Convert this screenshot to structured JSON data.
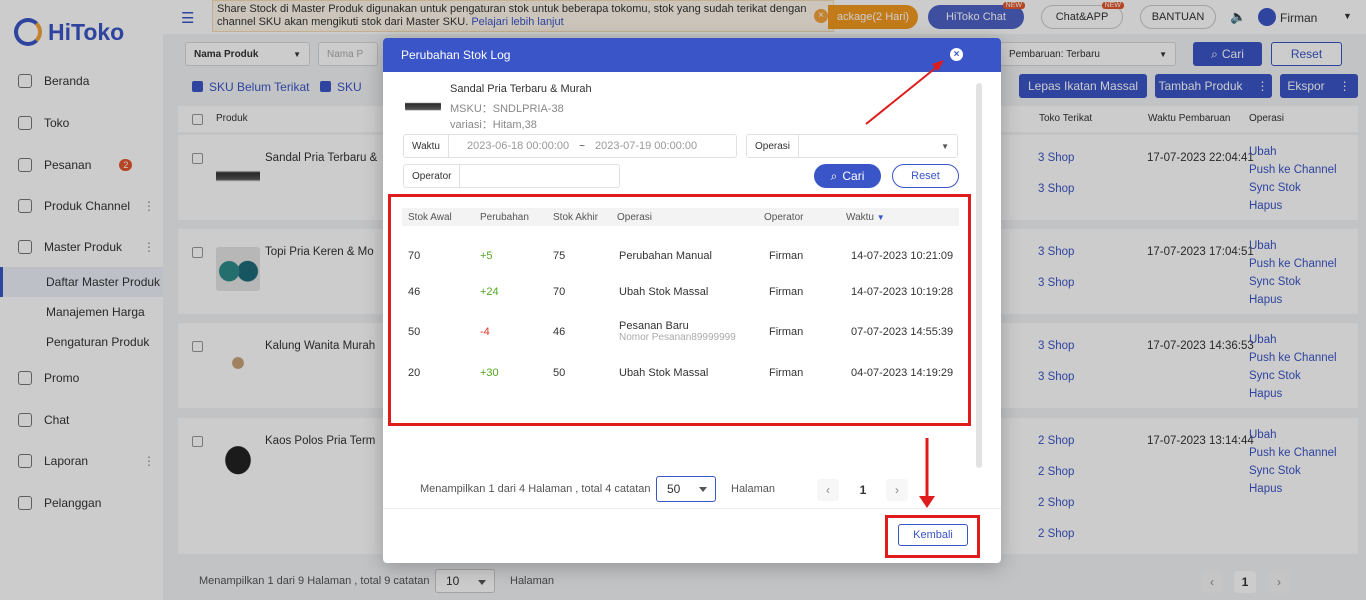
{
  "app": {
    "logo": "HiToko"
  },
  "sidebar": {
    "items": [
      {
        "label": "Beranda"
      },
      {
        "label": "Toko"
      },
      {
        "label": "Pesanan",
        "badge": "2"
      },
      {
        "label": "Produk Channel"
      },
      {
        "label": "Master Produk"
      },
      {
        "label": "Daftar Master Produk"
      },
      {
        "label": "Manajemen Harga"
      },
      {
        "label": "Pengaturan Produk"
      },
      {
        "label": "Promo"
      },
      {
        "label": "Chat"
      },
      {
        "label": "Laporan"
      },
      {
        "label": "Pelanggan"
      }
    ]
  },
  "topbar": {
    "notice_text": "Share Stock di Master Produk digunakan untuk pengaturan stok untuk beberapa tokomu, stok yang sudah terikat dengan channel SKU akan mengikuti stok dari Master SKU.",
    "notice_link": "Pelajari lebih lanjut",
    "package": "ackage(2 Hari)",
    "hitoko_chat": "HiToko Chat",
    "chat_app": "Chat&APP",
    "new_tag": "NEW",
    "bantuan": "BANTUAN",
    "user": "Firman"
  },
  "filters": {
    "nama_produk": "Nama Produk",
    "nama_p": "Nama P",
    "pembaruan": "Pembaruan: Terbaru",
    "cari": "Cari",
    "reset": "Reset",
    "sku_belum": "SKU Belum Terikat",
    "sku2": "SKU",
    "lepas": "Lepas Ikatan Massal",
    "tambah": "Tambah Produk",
    "ekspor": "Ekspor"
  },
  "list": {
    "headers": {
      "produk": "Produk",
      "toko": "Toko Terikat",
      "waktu": "Waktu Pembaruan",
      "operasi": "Operasi"
    },
    "ops": [
      "Ubah",
      "Push ke Channel",
      "Sync Stok",
      "Hapus"
    ],
    "products": [
      {
        "name": "Sandal Pria Terbaru &",
        "shops": [
          "3 Shop",
          "3 Shop"
        ],
        "time": "17-07-2023 22:04:41"
      },
      {
        "name": "Topi Pria Keren & Mo",
        "shops": [
          "3 Shop",
          "3 Shop"
        ],
        "time": "17-07-2023 17:04:51"
      },
      {
        "name": "Kalung Wanita Murah",
        "shops": [
          "3 Shop",
          "3 Shop"
        ],
        "time": "17-07-2023 14:36:53"
      },
      {
        "name": "Kaos Polos Pria Term",
        "shops": [
          "2 Shop",
          "2 Shop",
          "2 Shop",
          "2 Shop"
        ],
        "time": "17-07-2023 13:14:44"
      }
    ],
    "footer": {
      "text": "Menampilkan 1 dari 9 Halaman , total 9 catatan",
      "size": "10",
      "halaman": "Halaman",
      "page": "1"
    }
  },
  "modal": {
    "title": "Perubahan Stok Log",
    "product_name": "Sandal Pria Terbaru & Murah",
    "msku_label": "MSKU：",
    "msku": "SNDLPRIA-38",
    "variasi_label": "variasi：",
    "variasi": "Hitam,38",
    "waktu_label": "Waktu",
    "date_from": "2023-06-18 00:00:00",
    "date_sep": "~",
    "date_to": "2023-07-19 00:00:00",
    "operasi_label": "Operasi",
    "operator_label": "Operator",
    "cari": "Cari",
    "reset": "Reset",
    "columns": [
      "Stok Awal",
      "Perubahan",
      "Stok Akhir",
      "Operasi",
      "Operator",
      "Waktu"
    ],
    "rows": [
      {
        "awal": "70",
        "ubah": "+5",
        "akhir": "75",
        "operasi": "Perubahan Manual",
        "sub": "",
        "operator": "Firman",
        "waktu": "14-07-2023 10:21:09",
        "neg": false
      },
      {
        "awal": "46",
        "ubah": "+24",
        "akhir": "70",
        "operasi": "Ubah Stok Massal",
        "sub": "",
        "operator": "Firman",
        "waktu": "14-07-2023 10:19:28",
        "neg": false
      },
      {
        "awal": "50",
        "ubah": "-4",
        "akhir": "46",
        "operasi": "Pesanan Baru",
        "sub": "Nomor Pesanan89999999",
        "operator": "Firman",
        "waktu": "07-07-2023 14:55:39",
        "neg": true
      },
      {
        "awal": "20",
        "ubah": "+30",
        "akhir": "50",
        "operasi": "Ubah Stok Massal",
        "sub": "",
        "operator": "Firman",
        "waktu": "04-07-2023 14:19:29",
        "neg": false
      }
    ],
    "pager_text": "Menampilkan 1 dari 4 Halaman , total 4 catatan",
    "page_size": "50",
    "halaman": "Halaman",
    "page": "1",
    "kembali": "Kembali"
  },
  "colors": {
    "accent": "#3a55c7",
    "positive": "#52a824",
    "negative": "#e0352b",
    "highlight": "#e01b1b"
  }
}
